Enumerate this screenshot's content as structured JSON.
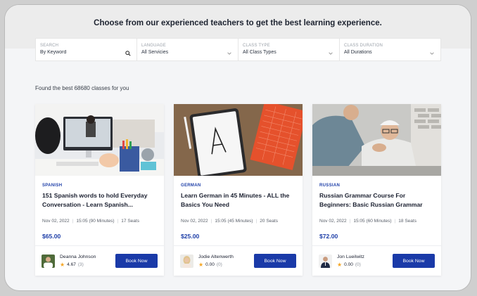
{
  "headline": "Choose from our experienced teachers to get the best learning experience.",
  "filters": [
    {
      "label": "SEARCH",
      "value": "By Keyword",
      "icon": "search-icon"
    },
    {
      "label": "LANGUAGE",
      "value": "All Servicies",
      "icon": "chevron-down-icon"
    },
    {
      "label": "CLASS TYPE",
      "value": "All Class Types",
      "icon": "chevron-down-icon"
    },
    {
      "label": "CLASS DURATION",
      "value": "All Durations",
      "icon": "chevron-down-icon"
    }
  ],
  "found_text": "Found the best 68680 classes for you",
  "accent_color": "#1a3aa8",
  "star_color": "#f5a623",
  "cards": [
    {
      "language": "SPANISH",
      "title": "151 Spanish words to hold Everyday Conversation - Learn Spanish...",
      "date": "Nov 02, 2022",
      "time": "15:05 (90 Minutes)",
      "seats": "17 Seats",
      "price": "$65.00",
      "teacher": "Deanna Johnson",
      "rating": "4.67",
      "reviews": "(3)",
      "button": "Book Now"
    },
    {
      "language": "GERMAN",
      "title": "Learn German in 45 Minutes - ALL the Basics You Need",
      "date": "Nov 02, 2022",
      "time": "15:05 (45 Minutes)",
      "seats": "20 Seats",
      "price": "$25.00",
      "teacher": "Jodie Altenwerth",
      "rating": "0.00",
      "reviews": "(0)",
      "button": "Book Now"
    },
    {
      "language": "RUSSIAN",
      "title": "Russian Grammar Course For Beginners: Basic Russian Grammar",
      "date": "Nov 02, 2022",
      "time": "15:05 (60 Minutes)",
      "seats": "18 Seats",
      "price": "$72.00",
      "teacher": "Jon Lueilwitz",
      "rating": "0.00",
      "reviews": "(0)",
      "button": "Book Now"
    }
  ]
}
